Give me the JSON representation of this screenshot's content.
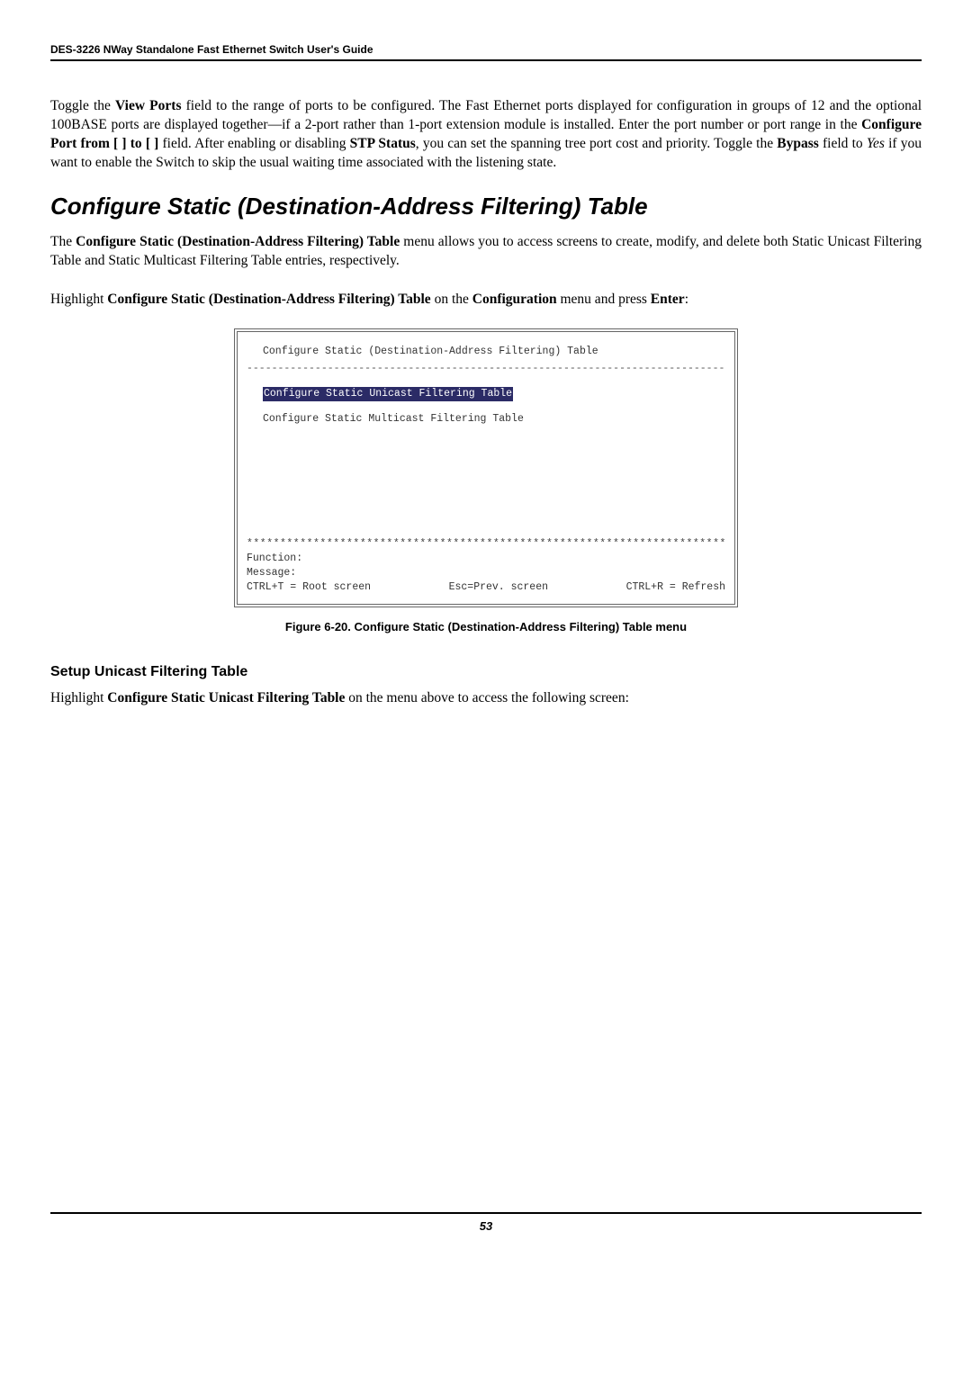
{
  "header": {
    "title": "DES-3226 NWay Standalone Fast Ethernet Switch User's Guide"
  },
  "para1": {
    "t1": "Toggle the ",
    "b1": "View Ports",
    "t2": " field to the range of ports to be configured. The Fast Ethernet ports displayed for configuration in groups of 12 and the optional 100BASE ports are displayed together—if a 2-port rather than 1-port extension module is installed. Enter the port number or port range in the ",
    "b2": "Configure Port from  [  ] to [  ]",
    "t3": " field. After enabling or disabling ",
    "b3": "STP Status",
    "t4": ", you can set the spanning tree port cost and priority. Toggle the ",
    "b4": "Bypass",
    "t5": " field to ",
    "i1": "Yes",
    "t6": " if you want to enable the Switch to skip the usual waiting time associated with the listening state."
  },
  "section": {
    "title": "Configure Static (Destination-Address Filtering) Table"
  },
  "para2": {
    "t1": "The ",
    "b1": "Configure Static (Destination-Address Filtering) Table",
    "t2": " menu allows you to access screens to create, modify, and delete both Static Unicast Filtering Table and Static Multicast Filtering Table entries, respectively."
  },
  "para3": {
    "t1": "Highlight ",
    "b1": "Configure Static (Destination-Address Filtering) Table",
    "t2": " on the ",
    "b2": "Configuration",
    "t3": " menu and press ",
    "b3": "Enter",
    "t4": ":"
  },
  "console": {
    "title": "Configure Static (Destination-Address Filtering) Table",
    "dashes": "--------------------------------------------------------------------------------",
    "item_hl": "Configure Static Unicast Filtering Table",
    "item2": "Configure Static Multicast Filtering Table",
    "stars": "********************************************************************************",
    "func": "Function:",
    "msg": "Message:",
    "root": "CTRL+T = Root screen",
    "esc": "Esc=Prev. screen",
    "refresh": "CTRL+R = Refresh"
  },
  "figcaption": "Figure 6-20.  Configure Static (Destination-Address Filtering) Table menu",
  "subheading": "Setup Unicast Filtering Table",
  "para4": {
    "t1": "Highlight ",
    "b1": "Configure Static Unicast Filtering Table",
    "t2": " on the menu above to access the following screen:"
  },
  "footer": {
    "page": "53"
  }
}
